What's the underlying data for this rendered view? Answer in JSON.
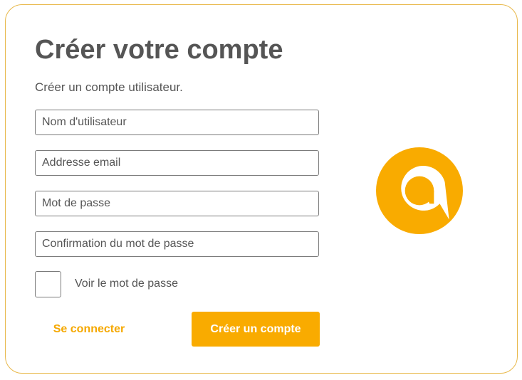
{
  "page": {
    "title": "Créer votre compte",
    "subtitle": "Créer un compte utilisateur."
  },
  "form": {
    "username": {
      "placeholder": "Nom d'utilisateur",
      "value": ""
    },
    "email": {
      "placeholder": "Addresse email",
      "value": ""
    },
    "password": {
      "placeholder": "Mot de passe",
      "value": ""
    },
    "password_confirm": {
      "placeholder": "Confirmation du mot de passe",
      "value": ""
    },
    "show_password": {
      "label": "Voir le mot de passe",
      "checked": false
    }
  },
  "actions": {
    "login_label": "Se connecter",
    "create_label": "Créer un compte"
  },
  "logo": {
    "icon": "brand-logo-icon"
  },
  "colors": {
    "accent": "#f9ab00",
    "link": "#f5a800",
    "border": "#e8b84a",
    "text": "#555555"
  }
}
